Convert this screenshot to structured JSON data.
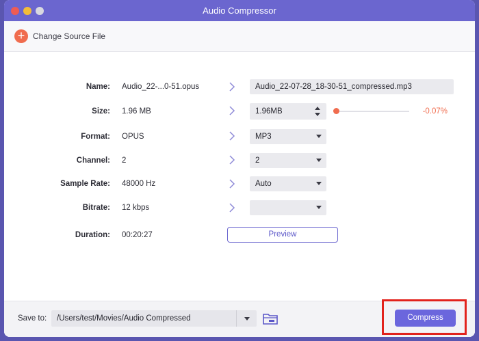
{
  "window": {
    "title": "Audio Compressor"
  },
  "toolbar": {
    "change_source_label": "Change Source File"
  },
  "rows": {
    "name": {
      "label": "Name:",
      "source": "Audio_22-...0-51.opus",
      "target": "Audio_22-07-28_18-30-51_compressed.mp3"
    },
    "size": {
      "label": "Size:",
      "source": "1.96 MB",
      "target": "1.96MB",
      "slider_level": 0.0,
      "change_percent": "-0.07%"
    },
    "format": {
      "label": "Format:",
      "source": "OPUS",
      "target": "MP3"
    },
    "channel": {
      "label": "Channel:",
      "source": "2",
      "target": "2"
    },
    "sample_rate": {
      "label": "Sample Rate:",
      "source": "48000 Hz",
      "target": "Auto"
    },
    "bitrate": {
      "label": "Bitrate:",
      "source": "12 kbps",
      "target": ""
    },
    "duration": {
      "label": "Duration:",
      "source": "00:20:27"
    }
  },
  "preview_label": "Preview",
  "save": {
    "label": "Save to:",
    "path": "/Users/test/Movies/Audio Compressed"
  },
  "compress_label": "Compress",
  "colors": {
    "accent": "#6b66dd",
    "highlight": "#e2221c",
    "slider": "#f06c4e"
  }
}
